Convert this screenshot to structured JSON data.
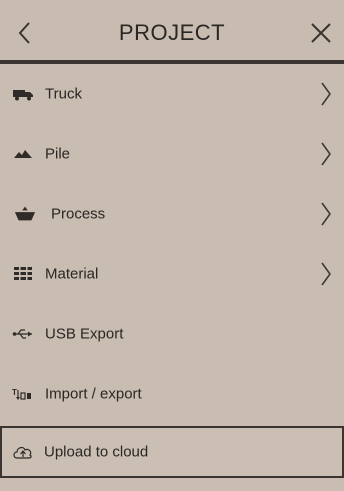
{
  "header": {
    "title": "PROJECT",
    "back_icon": "chevron-left-icon",
    "close_icon": "close-icon"
  },
  "menu": {
    "items": [
      {
        "label": "Truck",
        "icon": "truck-icon",
        "has_chevron": true
      },
      {
        "label": "Pile",
        "icon": "pile-icon",
        "has_chevron": true
      },
      {
        "label": "Process",
        "icon": "process-icon",
        "has_chevron": true
      },
      {
        "label": "Material",
        "icon": "material-icon",
        "has_chevron": true
      },
      {
        "label": "USB Export",
        "icon": "usb-icon",
        "has_chevron": false
      },
      {
        "label": "Import / export",
        "icon": "import-export-icon",
        "has_chevron": false
      },
      {
        "label": "Upload to cloud",
        "icon": "cloud-upload-icon",
        "has_chevron": false
      }
    ]
  },
  "colors": {
    "background": "#c9bcb1",
    "divider": "#3a3531",
    "text": "#2a2724"
  }
}
